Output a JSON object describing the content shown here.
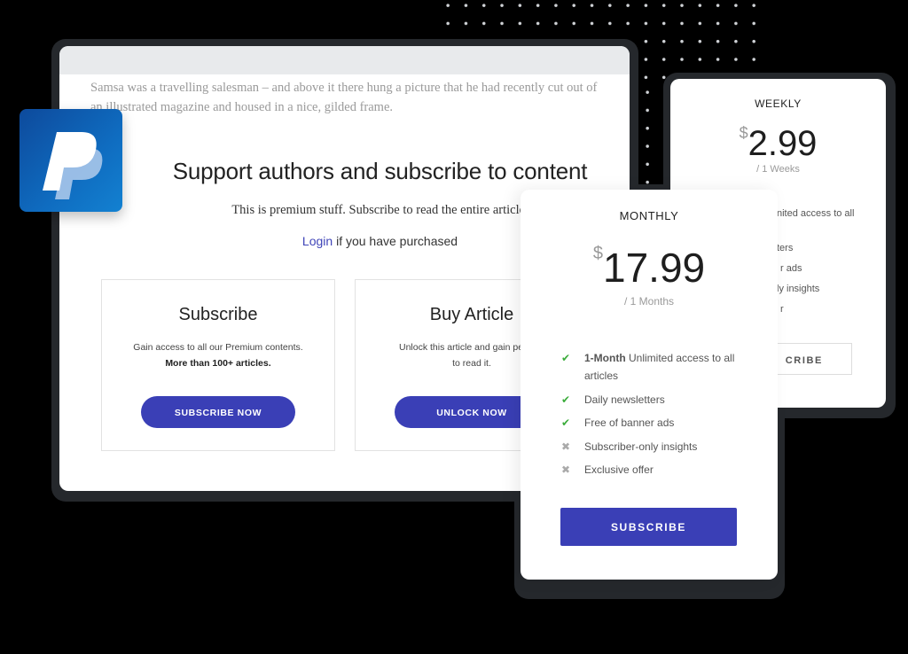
{
  "article": {
    "excerpt": "Samsa was a travelling salesman – and above it there hung a picture that he had recently cut out of an illustrated magazine and housed in a nice, gilded frame.",
    "headline": "Support authors and subscribe to content",
    "premium_note": "This is premium stuff. Subscribe to read the entire article.",
    "login_link": "Login",
    "login_suffix": " if you have purchased",
    "options": [
      {
        "title": "Subscribe",
        "line1": "Gain access to all our Premium contents.",
        "line2": "More than 100+ articles.",
        "button": "SUBSCRIBE NOW"
      },
      {
        "title": "Buy Article",
        "line1": "Unlock this article and gain perman",
        "line2": "to read it.",
        "button": "UNLOCK NOW"
      }
    ]
  },
  "plans": {
    "weekly": {
      "name": "WEEKLY",
      "currency": "$",
      "amount": "2.99",
      "period": "/ 1 Weeks",
      "features_visible": [
        "nited access to all",
        "ters",
        "r ads",
        "ly insights",
        "r"
      ],
      "button": "CRIBE"
    },
    "monthly": {
      "name": "MONTHLY",
      "currency": "$",
      "amount": "17.99",
      "period": "/ 1 Months",
      "features": [
        {
          "bold": "1-Month",
          "text": " Unlimited access to all articles",
          "included": true
        },
        {
          "bold": "",
          "text": "Daily newsletters",
          "included": true
        },
        {
          "bold": "",
          "text": "Free of banner ads",
          "included": true
        },
        {
          "bold": "",
          "text": "Subscriber-only insights",
          "included": false
        },
        {
          "bold": "",
          "text": "Exclusive offer",
          "included": false
        }
      ],
      "button": "SUBSCRIBE"
    }
  },
  "icons": {
    "check": "✔",
    "cross": "✖",
    "paypal": "paypal-logo-icon"
  },
  "colors": {
    "accent": "#3a3fb6",
    "check": "#3bac3b",
    "paypal": "#0f6cc0"
  }
}
